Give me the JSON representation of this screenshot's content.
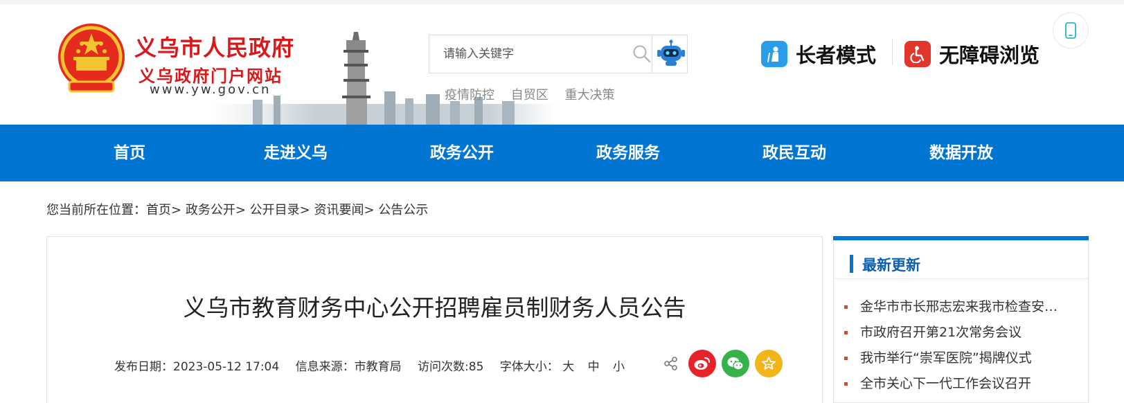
{
  "header": {
    "site_title": "义乌市人民政府",
    "site_subtitle": "义乌政府门户网站",
    "site_url": "www.yw.gov.cn",
    "search": {
      "placeholder": "请输入关键字"
    },
    "hotwords": [
      "疫情防控",
      "自贸区",
      "重大决策"
    ],
    "modes": {
      "elder_label": "长者模式",
      "access_label": "无障碍浏览"
    },
    "colors": {
      "brand_red": "#d8181b",
      "elder_icon": "#2a9de8",
      "access_icon": "#e2352c"
    }
  },
  "nav": {
    "items": [
      "首页",
      "走进义乌",
      "政务公开",
      "政务服务",
      "政民互动",
      "数据开放"
    ],
    "color": "#0075d1"
  },
  "breadcrumb": {
    "prefix": "您当前所在位置：",
    "items": [
      "首页",
      "政务公开",
      "公开目录",
      "资讯要闻",
      "公告公示"
    ],
    "separator": ">"
  },
  "article": {
    "title": "义乌市教育财务中心公开招聘雇员制财务人员公告",
    "publish_label": "发布日期：",
    "publish_date": "2023-05-12 17:04",
    "source_label": "信息来源：",
    "source": "市教育局",
    "visits_label": "访问次数:",
    "visits": "85",
    "fontsize_label": "字体大小：",
    "fontsize_options": [
      "大",
      "中",
      "小"
    ],
    "share_icons": [
      "weibo-icon",
      "wechat-icon",
      "favorite-icon"
    ]
  },
  "sidebar": {
    "title": "最新更新",
    "items": [
      "金华市市长邢志宏来我市检查安全生产工作",
      "市政府召开第21次常务会议",
      "我市举行“崇军医院”揭牌仪式",
      "全市关心下一代工作会议召开"
    ]
  }
}
